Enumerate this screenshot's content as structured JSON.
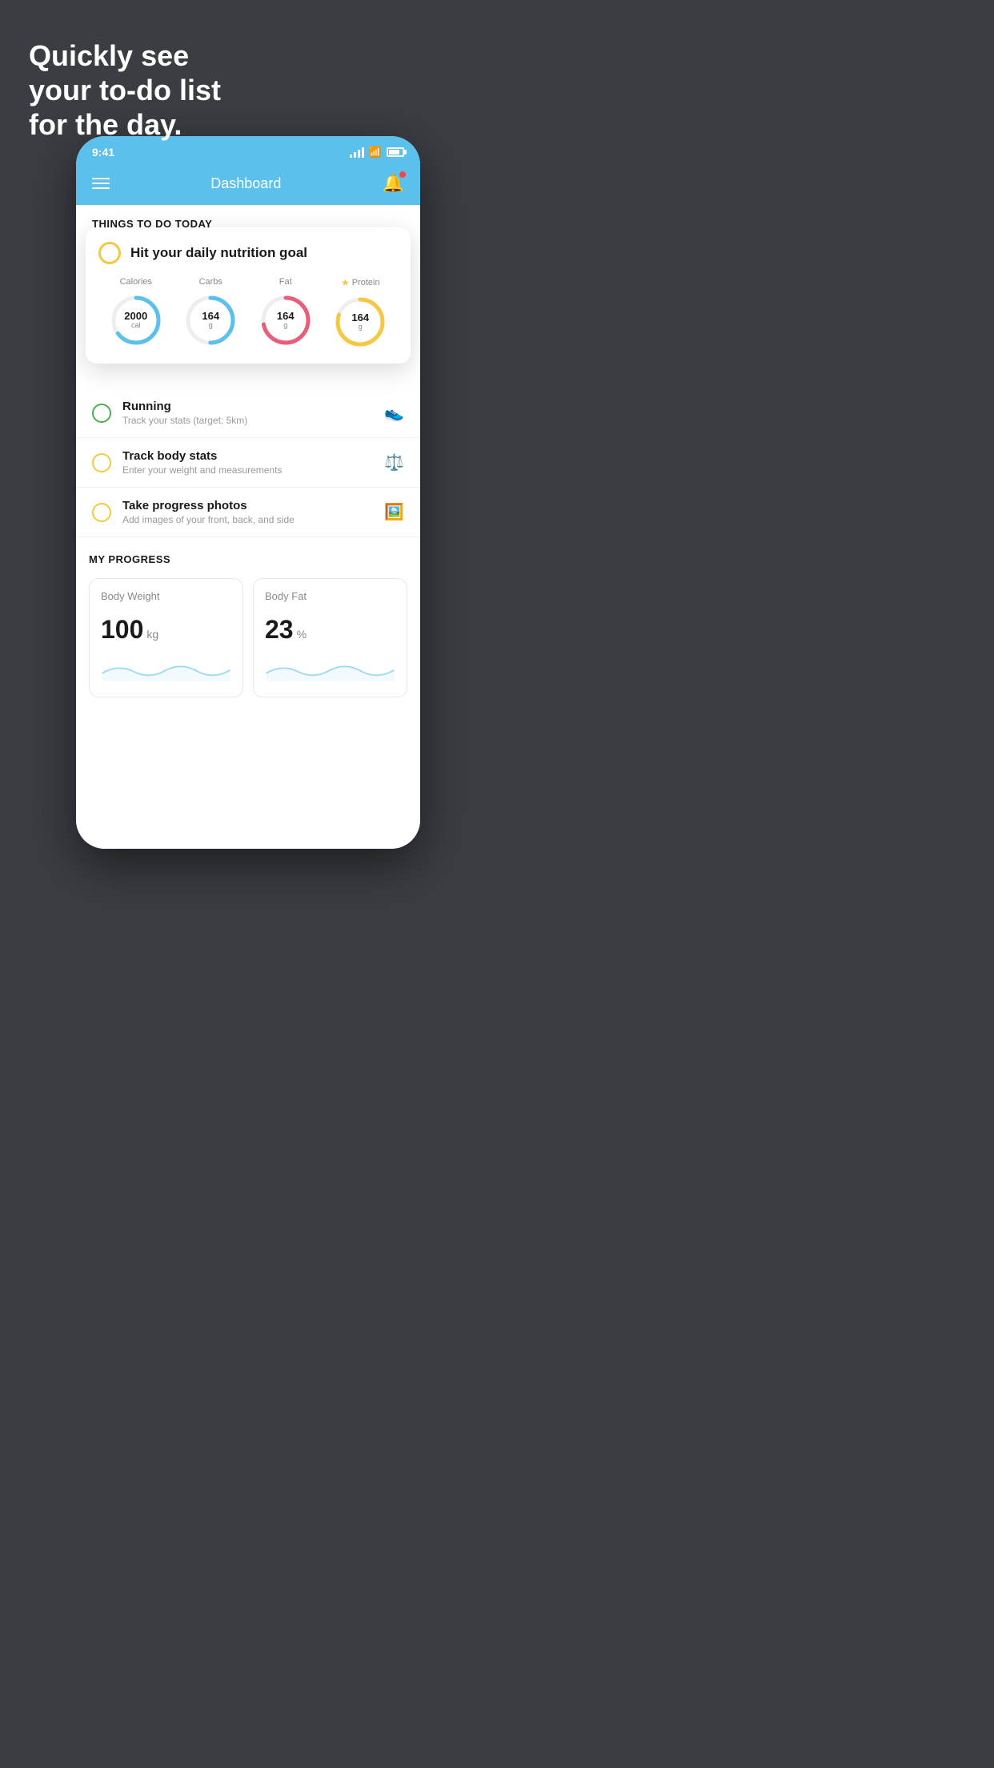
{
  "hero": {
    "line1": "Quickly see",
    "line2": "your to-do list",
    "line3": "for the day."
  },
  "status_bar": {
    "time": "9:41",
    "battery_level": 80
  },
  "header": {
    "title": "Dashboard"
  },
  "section_todo": {
    "title": "THINGS TO DO TODAY"
  },
  "nutrition_card": {
    "title": "Hit your daily nutrition goal",
    "metrics": [
      {
        "label": "Calories",
        "value": "2000",
        "unit": "cal",
        "color": "#5bc0eb",
        "progress": 0.65,
        "starred": false
      },
      {
        "label": "Carbs",
        "value": "164",
        "unit": "g",
        "color": "#5bc0eb",
        "progress": 0.5,
        "starred": false
      },
      {
        "label": "Fat",
        "value": "164",
        "unit": "g",
        "color": "#e85d7a",
        "progress": 0.72,
        "starred": false
      },
      {
        "label": "Protein",
        "value": "164",
        "unit": "g",
        "color": "#f5c842",
        "progress": 0.8,
        "starred": true
      }
    ]
  },
  "todo_items": [
    {
      "name": "Running",
      "desc": "Track your stats (target: 5km)",
      "circle_color": "green",
      "icon": "👟"
    },
    {
      "name": "Track body stats",
      "desc": "Enter your weight and measurements",
      "circle_color": "yellow",
      "icon": "⚖️"
    },
    {
      "name": "Take progress photos",
      "desc": "Add images of your front, back, and side",
      "circle_color": "yellow",
      "icon": "🖼️"
    }
  ],
  "progress_section": {
    "title": "MY PROGRESS",
    "cards": [
      {
        "title": "Body Weight",
        "value": "100",
        "unit": "kg"
      },
      {
        "title": "Body Fat",
        "value": "23",
        "unit": "%"
      }
    ]
  }
}
